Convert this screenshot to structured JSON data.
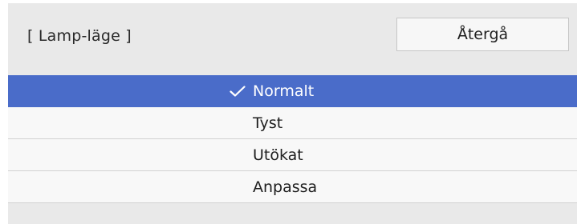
{
  "header": {
    "title": "[ Lamp-läge ]",
    "back_label": "Återgå"
  },
  "options": [
    {
      "label": "Normalt",
      "selected": true
    },
    {
      "label": "Tyst",
      "selected": false
    },
    {
      "label": "Utökat",
      "selected": false
    },
    {
      "label": "Anpassa",
      "selected": false
    }
  ],
  "icons": {
    "selected_marker": "check-icon"
  },
  "colors": {
    "selected_bg": "#4a6cc9",
    "panel_bg": "#e9e9e9",
    "item_bg": "#f8f8f8"
  }
}
